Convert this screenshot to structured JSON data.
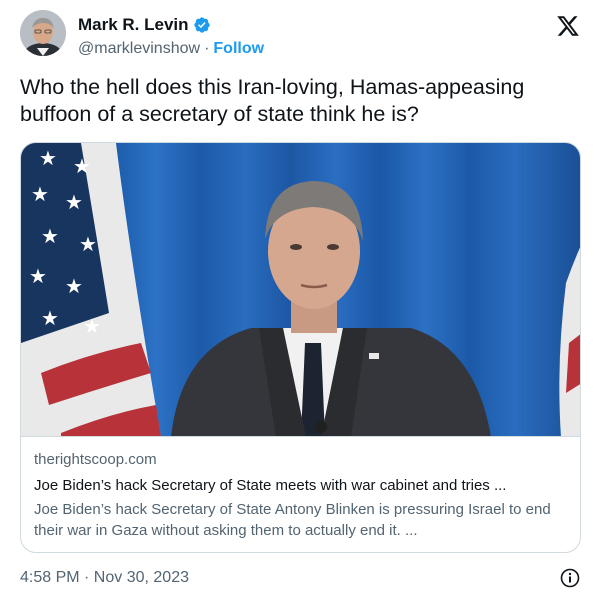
{
  "author": {
    "name": "Mark R. Levin",
    "handle": "@marklevinshow",
    "separator": "·",
    "follow_label": "Follow"
  },
  "tweet": {
    "text": "Who the hell does this Iran-loving, Hamas-appeasing buffoon of a secretary of state think he is?"
  },
  "card": {
    "domain": "therightscoop.com",
    "title": "Joe Biden’s hack Secretary of State meets with war cabinet and tries ...",
    "description": "Joe Biden’s hack Secretary of State Antony Blinken is pressuring Israel to end their war in Gaza without asking them to actually end it. ..."
  },
  "footer": {
    "timestamp": "4:58 PM · Nov 30, 2023"
  },
  "icons": {
    "verified": "verified-badge-icon",
    "x_logo": "x-logo-icon",
    "info": "info-icon"
  },
  "colors": {
    "accent": "#1d9bf0",
    "secondary_text": "#536471",
    "border": "#cfd9de",
    "curtain_blue": "#1f5fae"
  }
}
